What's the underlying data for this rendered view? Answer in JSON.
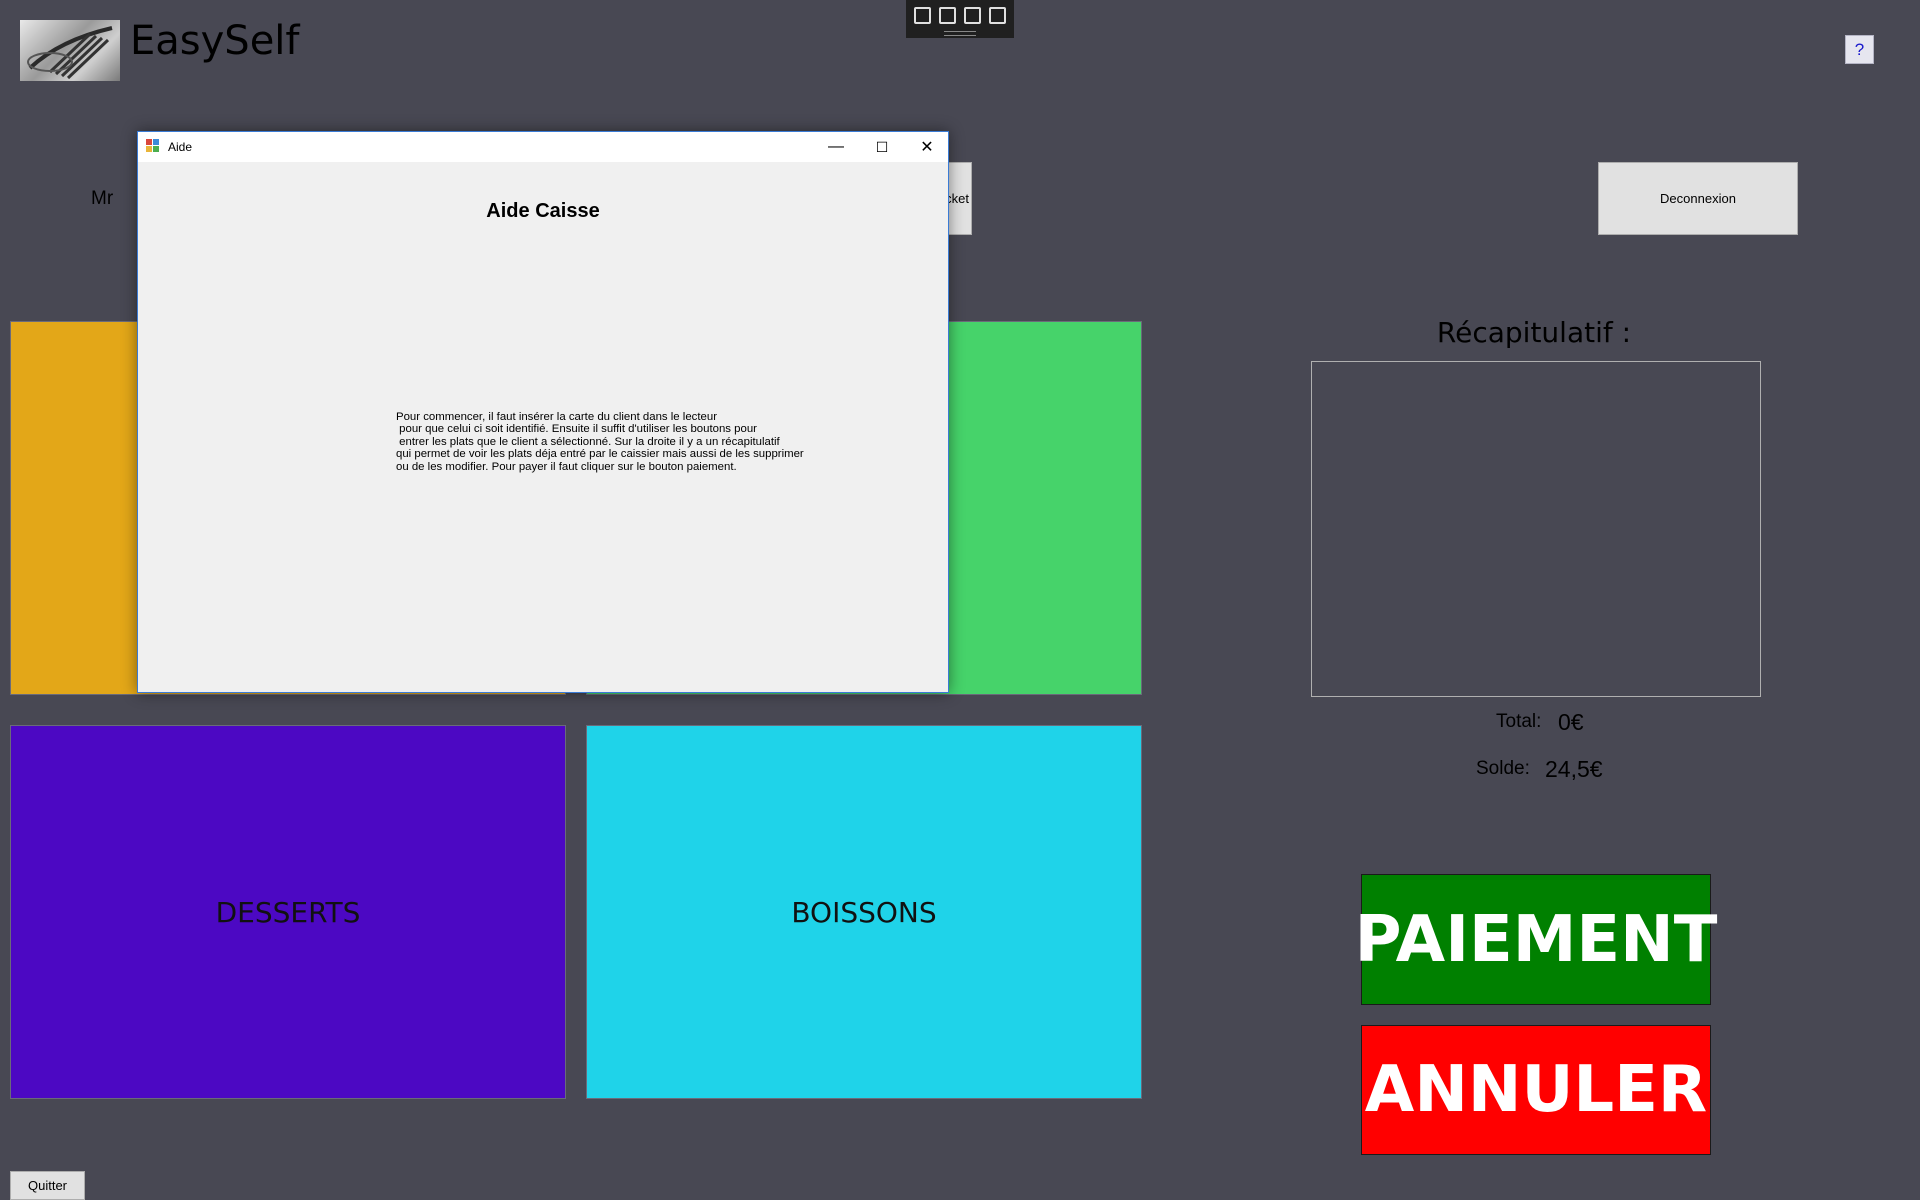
{
  "app": {
    "title": "EasySelf",
    "help_label": "?"
  },
  "user": {
    "greeting": "Mr"
  },
  "toolbar": {
    "ticket_label": "cket",
    "deconnexion_label": "Deconnexion",
    "quitter_label": "Quitter"
  },
  "debug_toolbar": {
    "icons": [
      "select-element-icon",
      "pointer-icon",
      "frame-icon",
      "track-focus-icon"
    ]
  },
  "categories": [
    {
      "label": "",
      "color": "#e3a718"
    },
    {
      "label": "",
      "color": "#46d36a"
    },
    {
      "label": "DESSERTS",
      "color": "#4c08c3"
    },
    {
      "label": "BOISSONS",
      "color": "#1fd3e9"
    }
  ],
  "recap": {
    "title": "Récapitulatif :",
    "total_label": "Total:",
    "total_value": "0€",
    "solde_label": "Solde:",
    "solde_value": "24,5€"
  },
  "actions": {
    "paiement_label": "PAIEMENT",
    "annuler_label": "ANNULER"
  },
  "aide_dialog": {
    "window_title": "Aide",
    "heading": "Aide Caisse",
    "body": "Pour commencer, il faut insérer la carte du client dans le lecteur\n pour que celui ci soit identifié. Ensuite il suffit d'utiliser les boutons pour\n entrer les plats que le client a sélectionné. Sur la droite il y a un récapitulatif\nqui permet de voir les plats déja entré par le caissier mais aussi de les supprimer\nou de les modifier. Pour payer il faut cliquer sur le bouton paiement.",
    "controls": {
      "minimize": "—",
      "maximize": "☐",
      "close": "✕"
    }
  },
  "colors": {
    "background": "#484853",
    "paiement": "#008000",
    "annuler": "#ff0000",
    "dialog_border": "#3a7bd5"
  }
}
